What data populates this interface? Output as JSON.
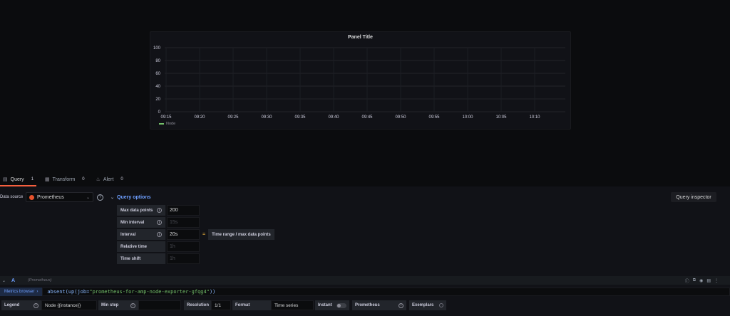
{
  "panel": {
    "title": "Panel Title",
    "legend_label": "Node"
  },
  "chart_data": {
    "type": "line",
    "title": "Panel Title",
    "y_ticks": [
      "100",
      "80",
      "60",
      "40",
      "20",
      "0"
    ],
    "x_ticks": [
      "09:15",
      "09:20",
      "09:25",
      "09:30",
      "09:35",
      "09:40",
      "09:45",
      "09:50",
      "09:55",
      "10:00",
      "10:05",
      "10:10"
    ],
    "ylim": [
      0,
      100
    ],
    "series": [
      {
        "name": "Node",
        "values": []
      }
    ],
    "grid": true,
    "legend": "bottom-left"
  },
  "tabs": [
    {
      "label": "Query",
      "count": "1",
      "icon": "database-icon"
    },
    {
      "label": "Transform",
      "count": "0",
      "icon": "transform-icon"
    },
    {
      "label": "Alert",
      "count": "0",
      "icon": "bell-icon"
    }
  ],
  "datasource": {
    "label": "Data source",
    "selected": "Prometheus",
    "query_options_label": "Query options"
  },
  "query_inspector_label": "Query inspector",
  "query_options": [
    {
      "label": "Max data points",
      "value": "200",
      "placeholder": false
    },
    {
      "label": "Min interval",
      "value": "15s",
      "placeholder": true
    },
    {
      "label": "Interval",
      "value": "20s",
      "placeholder": false
    },
    {
      "label": "Relative time",
      "value": "1h",
      "placeholder": true
    },
    {
      "label": "Time shift",
      "value": "1h",
      "placeholder": true
    }
  ],
  "interval_aside": "Time range / max data points",
  "query": {
    "letter": "A",
    "datasource_hint": "(Prometheus)",
    "metrics_browser_label": "Metrics browser",
    "expr_fn": "absent(up(job=",
    "expr_str": "\"prometheus-for-amp-node-exporter-gfqg4\"",
    "expr_end": "))"
  },
  "query_row_options": {
    "legend_label": "Legend",
    "legend_value": "Node {{instance}}",
    "min_step_label": "Min step",
    "resolution_label": "Resolution",
    "resolution_value": "1/1",
    "format_label": "Format",
    "format_value": "Time series",
    "instant_label": "Instant",
    "type_label": "Prometheus",
    "exemplars_label": "Exemplars"
  },
  "colors": {
    "accent": "#6e9fff",
    "active_tab": "#f55f3e",
    "series": "#73bf69"
  }
}
